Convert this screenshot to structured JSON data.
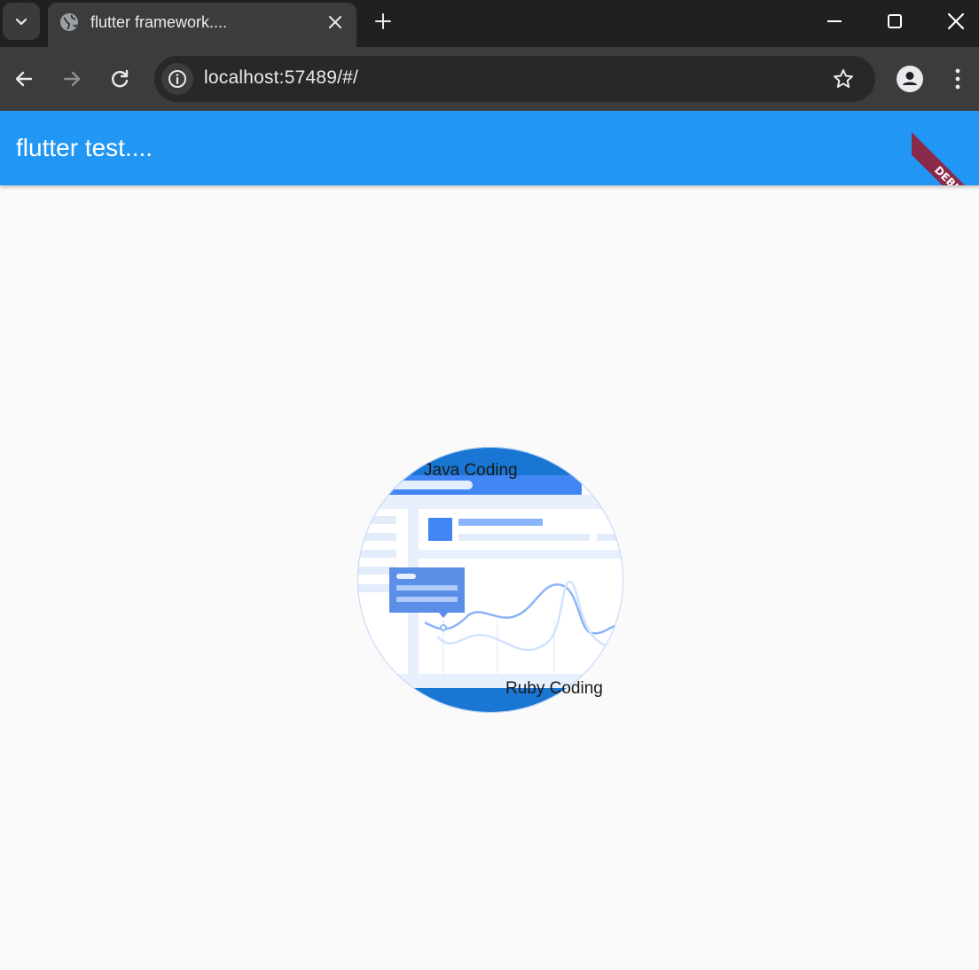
{
  "browser": {
    "tab": {
      "title": "flutter framework....",
      "favicon": "globe-icon"
    },
    "address_bar": {
      "url": "localhost:57489/#/"
    },
    "icons": {
      "tab_search": "chevron-down-icon",
      "close_tab": "close-icon",
      "new_tab": "plus-icon",
      "minimize": "minimize-icon",
      "maximize": "maximize-icon",
      "close_window": "close-icon",
      "back": "arrow-left-icon",
      "forward": "arrow-right-icon",
      "reload": "reload-icon",
      "site_info": "info-icon",
      "bookmark": "star-icon",
      "profile": "profile-icon",
      "menu": "kebab-menu-icon"
    }
  },
  "app": {
    "title": "flutter test....",
    "debug_banner": "DEBUG",
    "accent_color": "#2196f3",
    "circle": {
      "top_label": "Java Coding",
      "bottom_label": "Ruby Coding"
    }
  }
}
